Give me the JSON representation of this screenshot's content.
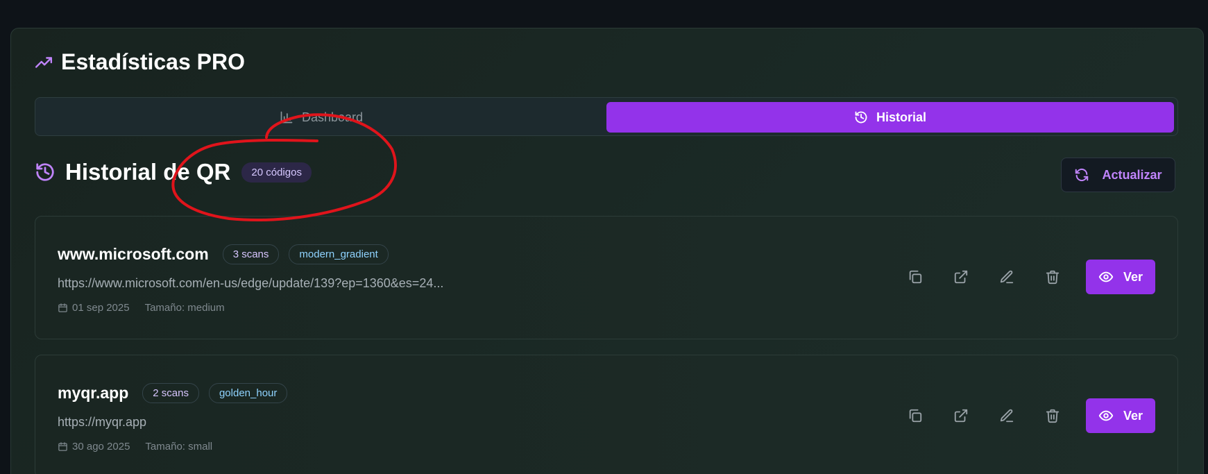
{
  "panel": {
    "title": "Estadísticas PRO",
    "title_icon": "trending-up-icon"
  },
  "tabs": [
    {
      "label": "Dashboard",
      "icon": "bar-chart-icon",
      "active": false
    },
    {
      "label": "Historial",
      "icon": "history-icon",
      "active": true
    }
  ],
  "history": {
    "title": "Historial de QR",
    "count_badge": "20 códigos",
    "refresh_label": "Actualizar"
  },
  "items": [
    {
      "name": "www.microsoft.com",
      "scans": "3 scans",
      "style": "modern_gradient",
      "url": "https://www.microsoft.com/en-us/edge/update/139?ep=1360&es=24...",
      "date": "01 sep 2025",
      "size": "Tamaño: medium",
      "view_label": "Ver"
    },
    {
      "name": "myqr.app",
      "scans": "2 scans",
      "style": "golden_hour",
      "url": "https://myqr.app",
      "date": "30 ago 2025",
      "size": "Tamaño: small",
      "view_label": "Ver"
    }
  ],
  "colors": {
    "accent": "#9333ea",
    "accent_text": "#c084fc",
    "annotation": "#e0141b"
  }
}
